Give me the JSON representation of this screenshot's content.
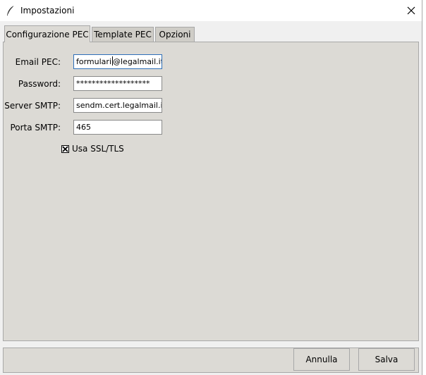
{
  "window": {
    "title": "Impostazioni",
    "icon": "feather-icon",
    "close_icon": "close-icon"
  },
  "tabs": [
    {
      "label": "Configurazione PEC",
      "active": true
    },
    {
      "label": "Template PEC",
      "active": false
    },
    {
      "label": "Opzioni",
      "active": false
    }
  ],
  "form": {
    "email": {
      "label": "Email PEC:",
      "value": "formulari@legalmail.it"
    },
    "password": {
      "label": "Password:",
      "value": "*******************"
    },
    "smtp_server": {
      "label": "Server SMTP:",
      "value": "sendm.cert.legalmail.it"
    },
    "smtp_port": {
      "label": "Porta SMTP:",
      "value": "465"
    },
    "ssl": {
      "label": "Usa SSL/TLS",
      "checked": true
    }
  },
  "buttons": {
    "cancel": "Annulla",
    "save": "Salva"
  },
  "colors": {
    "panel_background": "#dcdad5",
    "titlebar_background": "#ffffff",
    "focus_border": "#2e6fb8"
  }
}
